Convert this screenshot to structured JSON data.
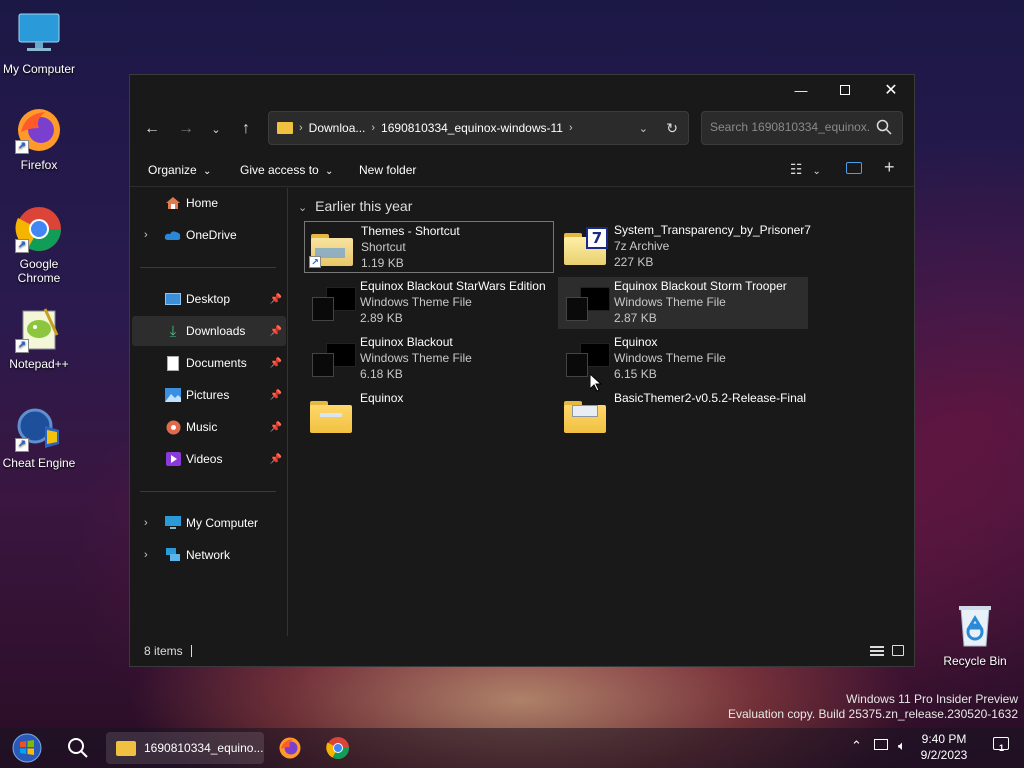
{
  "desktop": {
    "icons": [
      {
        "label": "My Computer",
        "icon": "monitor-icon"
      },
      {
        "label": "Firefox",
        "icon": "firefox-icon"
      },
      {
        "label": "Google Chrome",
        "icon": "chrome-icon"
      },
      {
        "label": "Notepad++",
        "icon": "notepadpp-icon"
      },
      {
        "label": "Cheat Engine",
        "icon": "cheat-engine-icon"
      },
      {
        "label": "Recycle Bin",
        "icon": "recycle-bin-icon"
      }
    ],
    "watermark_line1": "Windows 11 Pro Insider Preview",
    "watermark_line2": "Evaluation copy. Build 25375.zn_release.230520-1632"
  },
  "explorer": {
    "address": {
      "seg1": "Downloa...",
      "seg2": "1690810334_equinox-windows-11"
    },
    "search_placeholder": "Search 1690810334_equinox...",
    "commands": {
      "organize": "Organize",
      "give_access": "Give access to",
      "new_folder": "New folder"
    },
    "sidebar": {
      "home": "Home",
      "onedrive": "OneDrive",
      "desktop": "Desktop",
      "downloads": "Downloads",
      "documents": "Documents",
      "pictures": "Pictures",
      "music": "Music",
      "videos": "Videos",
      "my_computer": "My Computer",
      "network": "Network"
    },
    "group_header": "Earlier this year",
    "files": [
      {
        "name": "Themes - Shortcut",
        "type": "Shortcut",
        "size": "1.19 KB"
      },
      {
        "name": "System_Transparency_by_Prisoner7",
        "type": "7z Archive",
        "size": "227 KB"
      },
      {
        "name": "Equinox Blackout StarWars Edition",
        "type": "Windows Theme File",
        "size": "2.89 KB"
      },
      {
        "name": "Equinox Blackout Storm Trooper",
        "type": "Windows Theme File",
        "size": "2.87 KB"
      },
      {
        "name": "Equinox Blackout",
        "type": "Windows Theme File",
        "size": "6.18 KB"
      },
      {
        "name": "Equinox",
        "type": "Windows Theme File",
        "size": "6.15 KB"
      },
      {
        "name": "Equinox",
        "type": "",
        "size": ""
      },
      {
        "name": "BasicThemer2-v0.5.2-Release-Final",
        "type": "",
        "size": ""
      }
    ],
    "status": "8 items"
  },
  "taskbar": {
    "active_window": "1690810334_equino...",
    "time": "9:40 PM",
    "date": "9/2/2023",
    "notification_count": "1"
  },
  "colors": {
    "window_bg": "#191919",
    "folder_yellow": "#f0c040",
    "accent_blue": "#1a5fd0"
  }
}
